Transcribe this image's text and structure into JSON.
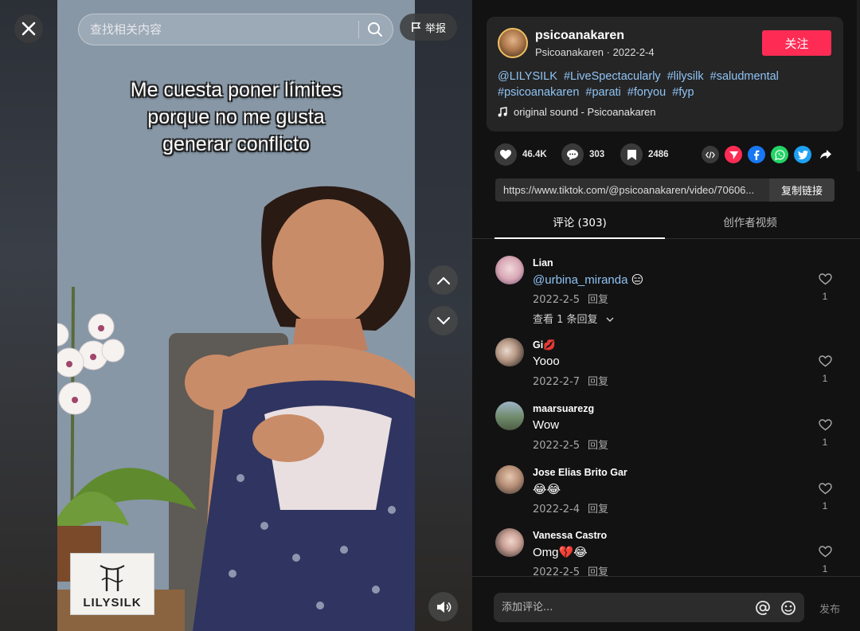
{
  "colors": {
    "accent": "#fe2c55",
    "link": "#8fc3f5",
    "panel": "#121212",
    "card": "#252525"
  },
  "search": {
    "placeholder": "查找相关内容"
  },
  "header": {
    "report_label": "举报"
  },
  "video": {
    "caption_lines": [
      "Me cuesta poner límites",
      "porque no me gusta",
      "generar conflicto"
    ],
    "brand_text": "LILYSILK"
  },
  "author": {
    "username": "psicoanakaren",
    "nickname": "Psicoanakaren",
    "date": "2022-2-4",
    "follow_label": "关注",
    "hashtags": [
      "@LILYSILK",
      "#LiveSpectacularly",
      "#lilysilk",
      "#saludmental",
      "#psicoanakaren",
      "#parati",
      "#foryou",
      "#fyp"
    ],
    "sound": "original sound - Psicoanakaren"
  },
  "stats": {
    "likes": "46.4K",
    "comments": "303",
    "saves": "2486"
  },
  "share_icons": [
    "embed-icon",
    "send-icon",
    "facebook-icon",
    "whatsapp-icon",
    "twitter-icon",
    "share-arrow-icon"
  ],
  "link": {
    "url": "https://www.tiktok.com/@psicoanakaren/video/70606...",
    "copy_label": "复制链接"
  },
  "tabs": [
    {
      "label": "评论 (303)"
    },
    {
      "label": "创作者视频"
    }
  ],
  "comments": [
    {
      "name": "Lian",
      "mention": "@urbina_miranda",
      "text": " 😑",
      "date": "2022-2-5",
      "reply": "回复",
      "likes": "1",
      "more": "查看 1 条回复"
    },
    {
      "name": "Gi💋",
      "text": "Yooo",
      "date": "2022-2-7",
      "reply": "回复",
      "likes": "1"
    },
    {
      "name": "maarsuarezg",
      "text": "Wow",
      "date": "2022-2-5",
      "reply": "回复",
      "likes": "1"
    },
    {
      "name": "Jose Elias Brito Gar",
      "text": "😂😂",
      "date": "2022-2-4",
      "reply": "回复",
      "likes": "1"
    },
    {
      "name": "Vanessa Castro",
      "text": "Omg💔😂",
      "date": "2022-2-5",
      "reply": "回复",
      "likes": "1"
    }
  ],
  "footer": {
    "placeholder": "添加评论...",
    "post_label": "发布"
  }
}
